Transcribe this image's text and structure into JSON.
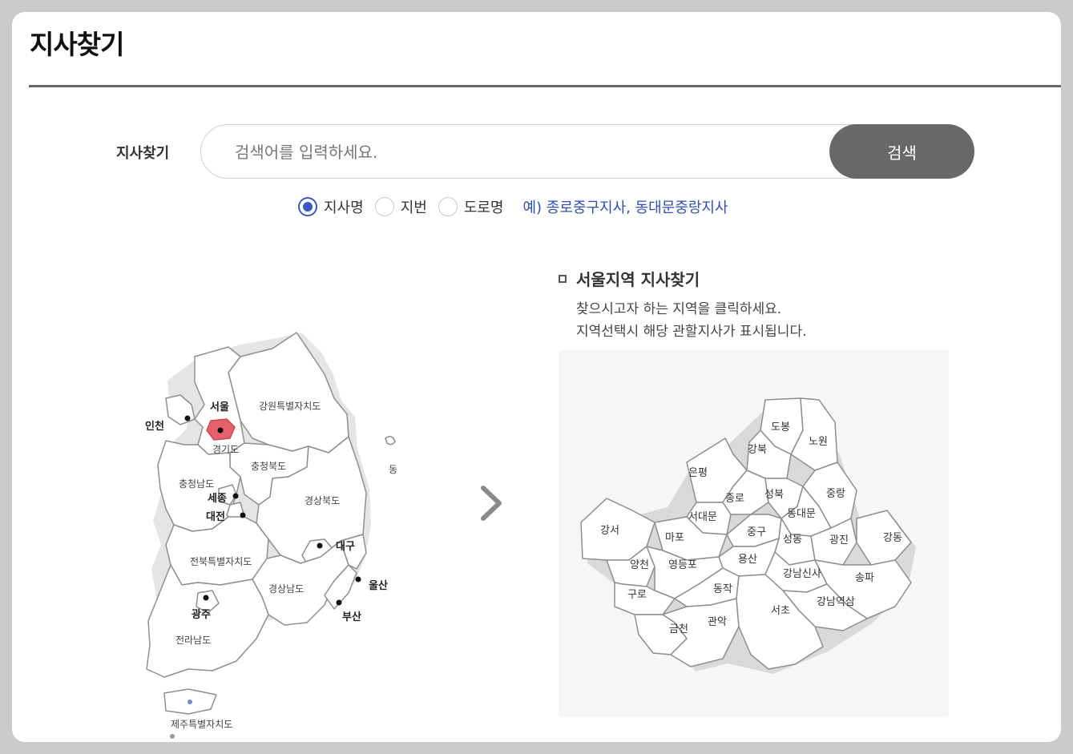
{
  "page": {
    "title": "지사찾기"
  },
  "search": {
    "label": "지사찾기",
    "placeholder": "검색어를 입력하세요.",
    "value": "",
    "button_label": "검색"
  },
  "search_options": [
    {
      "label": "지사명",
      "selected": true
    },
    {
      "label": "지번",
      "selected": false
    },
    {
      "label": "도로명",
      "selected": false
    }
  ],
  "search_hint": "예) 종로중구지사, 동대문중랑지사",
  "korea_map": {
    "regions": [
      "서울",
      "인천",
      "경기도",
      "강원특별자치도",
      "충청북도",
      "충청남도",
      "세종",
      "대전",
      "경상북도",
      "대구",
      "전북특별자치도",
      "경상남도",
      "울산",
      "부산",
      "광주",
      "전라남도",
      "제주특별자치도",
      "동해"
    ],
    "selected_region": "서울",
    "selected_color": "#e5606a"
  },
  "seoul": {
    "title": "서울지역 지사찾기",
    "desc_line1": "찾으시고자 하는 지역을 클릭하세요.",
    "desc_line2": "지역선택시 해당 관할지사가 표시됩니다.",
    "districts": [
      "도봉",
      "노원",
      "강북",
      "은평",
      "종로",
      "성북",
      "중랑",
      "서대문",
      "동대문",
      "강서",
      "마포",
      "중구",
      "성동",
      "광진",
      "강동",
      "용산",
      "양천",
      "영등포",
      "강남신사",
      "송파",
      "구로",
      "동작",
      "강남역삼",
      "금천",
      "관악",
      "서초"
    ]
  },
  "icons": {
    "next": "chevron-right-icon",
    "bullet": "square-bullet-icon"
  }
}
